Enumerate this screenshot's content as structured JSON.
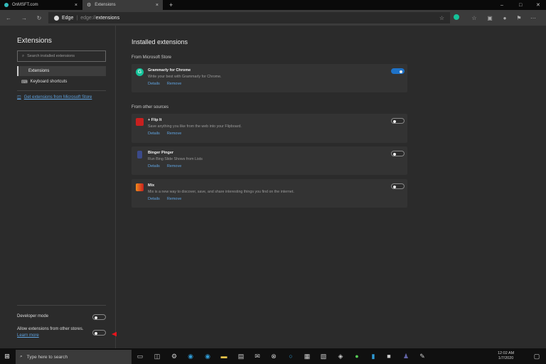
{
  "browser": {
    "tabs": [
      {
        "label": "OnMSFT.com"
      },
      {
        "label": "Extensions"
      }
    ],
    "new_tab": "+",
    "close": "×",
    "brand": "Edge",
    "url_prefix": "edge://",
    "url_path": "extensions",
    "window": {
      "min": "–",
      "max": "□",
      "close": "✕"
    }
  },
  "sidebar": {
    "title": "Extensions",
    "search_placeholder": "Search installed extensions",
    "items": [
      {
        "label": "Extensions"
      },
      {
        "label": "Keyboard shortcuts"
      }
    ],
    "store_link": "Get extensions from Microsoft Store",
    "developer_mode": "Developer mode",
    "allow_other": "Allow extensions from other stores.",
    "learn_more": "Learn more"
  },
  "main": {
    "title": "Installed extensions",
    "section_store": "From Microsoft Store",
    "section_other": "From other sources",
    "details": "Details",
    "remove": "Remove",
    "extensions": [
      {
        "name": "Grammarly for Chrome",
        "desc": "Write your best with Grammarly for Chrome.",
        "enabled": true,
        "icon_color": "#15c39a"
      },
      {
        "name": "+ Flip It",
        "desc": "Save anything you like from the web into your Flipboard.",
        "enabled": false,
        "icon_color": "#c8201f"
      },
      {
        "name": "Binger Pinger",
        "desc": "Run Bing Slide Shows from Lists",
        "enabled": false,
        "icon_color": "#3b4a8a"
      },
      {
        "name": "Mix",
        "desc": "Mix is a new way to discover, save, and share interesting things you find on the internet.",
        "enabled": false,
        "icon_color": "#f08a1c"
      }
    ]
  },
  "taskbar": {
    "search_placeholder": "Type here to search",
    "time": "12:02 AM",
    "date": "1/7/2020"
  },
  "annotation": {
    "arrow_color": "#e8141c"
  }
}
